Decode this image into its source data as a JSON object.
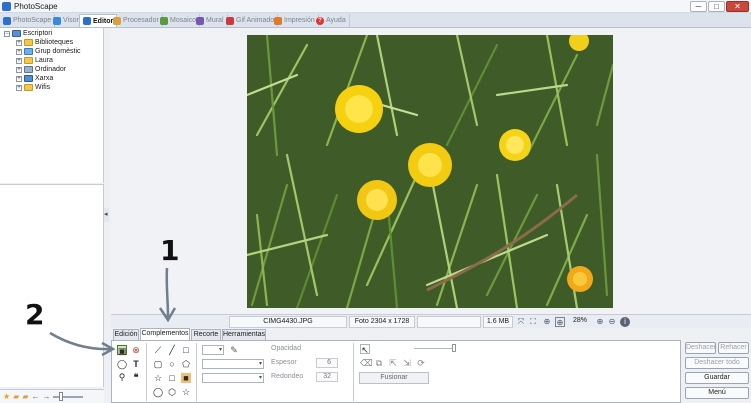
{
  "app": {
    "title": "PhotoScape"
  },
  "window_controls": {
    "minimize": "─",
    "maximize": "□",
    "close": "✕"
  },
  "main_tabs": [
    {
      "label": "PhotoScape",
      "color": "#2c6fd1"
    },
    {
      "label": "Visor",
      "color": "#3b8ad8"
    },
    {
      "label": "Editor",
      "color": "#2a72c9"
    },
    {
      "label": "Procesador",
      "color": "#d9a13a"
    },
    {
      "label": "Mosaico",
      "color": "#5a9a3e"
    },
    {
      "label": "Mural",
      "color": "#7a56b3"
    },
    {
      "label": "Gif Animado",
      "color": "#cc3b3b"
    },
    {
      "label": "Impresión",
      "color": "#e07a2a"
    },
    {
      "label": "Ayuda",
      "color": "#d33333"
    }
  ],
  "folder_tree": {
    "root": "Escriptori",
    "items": [
      "Biblioteques",
      "Grup domèstic",
      "Laura",
      "Ordinador",
      "Xarxa",
      "Wifis"
    ]
  },
  "status": {
    "filename": "CIMG4430.JPG",
    "photo_info": "Foto 2304 x 1728",
    "filesize": "1.6 MB",
    "zoom": "28%"
  },
  "editor_tabs": [
    "Edición",
    "Complementos",
    "Recorte",
    "Herramientas"
  ],
  "active_editor_tab": "Complementos",
  "tool_panel": {
    "opacity_label": "Opacidad",
    "thickness_label": "Espesor",
    "thickness_value": "6",
    "rounding_label": "Redondeo",
    "rounding_value": "32",
    "merge_button": "Fusionar"
  },
  "right_buttons": {
    "undo": "Deshacer",
    "redo": "Rehacer",
    "undo_all": "Deshacer todo",
    "save": "Guardar",
    "menu": "Menú"
  },
  "annotations": {
    "one": "1",
    "two": "2"
  }
}
